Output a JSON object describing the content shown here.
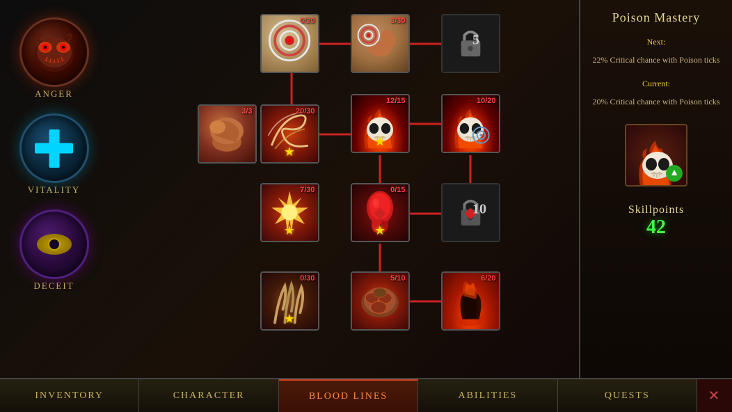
{
  "title": "Blood Lines",
  "leftSidebar": {
    "anger": {
      "label": "Anger"
    },
    "vitality": {
      "label": "Vitality"
    },
    "deceit": {
      "label": "Deceit"
    }
  },
  "skillTree": {
    "nodes": [
      {
        "id": "archery1",
        "label": "0/20",
        "hasStar": false,
        "locked": false,
        "col": 2,
        "row": 0
      },
      {
        "id": "archery2",
        "label": "3/30",
        "hasStar": false,
        "locked": false,
        "col": 3,
        "row": 0
      },
      {
        "id": "locked1",
        "label": "",
        "locked": true,
        "lockNum": "5",
        "col": 4,
        "row": 0
      },
      {
        "id": "strength",
        "label": "3/3",
        "hasStar": false,
        "locked": false,
        "col": 1,
        "row": 1
      },
      {
        "id": "wind",
        "label": "20/30",
        "hasStar": true,
        "locked": false,
        "col": 2,
        "row": 1
      },
      {
        "id": "flameskull1",
        "label": "12/15",
        "hasStar": true,
        "locked": false,
        "col": 3,
        "row": 1
      },
      {
        "id": "flameskull2",
        "label": "10/20",
        "hasStar": false,
        "locked": false,
        "col": 4,
        "row": 1
      },
      {
        "id": "starburst",
        "label": "7/30",
        "hasStar": true,
        "locked": false,
        "col": 2,
        "row": 2
      },
      {
        "id": "blood",
        "label": "0/15",
        "hasStar": true,
        "locked": false,
        "col": 3,
        "row": 2
      },
      {
        "id": "locked2",
        "label": "",
        "locked": true,
        "lockNum": "10",
        "col": 4,
        "row": 2
      },
      {
        "id": "claw",
        "label": "0/30",
        "hasStar": true,
        "locked": false,
        "col": 2,
        "row": 3
      },
      {
        "id": "muscle",
        "label": "5/10",
        "hasStar": false,
        "locked": false,
        "col": 3,
        "row": 3
      },
      {
        "id": "shadow",
        "label": "6/20",
        "hasStar": false,
        "locked": false,
        "col": 4,
        "row": 3
      }
    ]
  },
  "rightPanel": {
    "title": "Poison Mastery",
    "nextLabel": "Next:",
    "nextDesc": "22% Critical chance with Poison ticks",
    "currentLabel": "Current:",
    "currentDesc": "20% Critical chance with Poison ticks",
    "skillpointsLabel": "Skillpoints",
    "skillpointsValue": "42"
  },
  "bottomNav": {
    "items": [
      {
        "id": "inventory",
        "label": "Inventory",
        "active": false
      },
      {
        "id": "character",
        "label": "Character",
        "active": false
      },
      {
        "id": "bloodlines",
        "label": "Blood Lines",
        "active": true
      },
      {
        "id": "abilities",
        "label": "Abilities",
        "active": false
      },
      {
        "id": "quests",
        "label": "Quests",
        "active": false
      }
    ],
    "closeLabel": "✕"
  }
}
